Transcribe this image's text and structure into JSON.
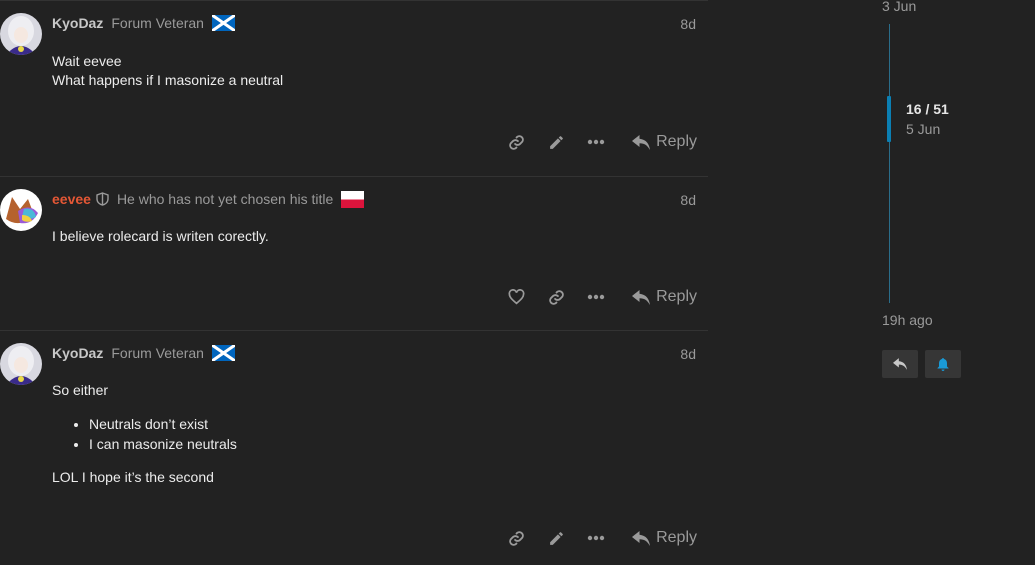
{
  "posts": [
    {
      "username": "KyoDaz",
      "title": "Forum Veteran",
      "date": "8d",
      "paragraphs": [
        "Wait eevee",
        "What happens if I masonize a neutral"
      ],
      "reply_label": "Reply"
    },
    {
      "username": "eevee",
      "title": "He who has not yet chosen his title",
      "date": "8d",
      "paragraphs": [
        "I believe rolecard is writen corectly."
      ],
      "reply_label": "Reply"
    },
    {
      "username": "KyoDaz",
      "title": "Forum Veteran",
      "date": "8d",
      "intro": "So either",
      "bullets": [
        "Neutrals don’t exist",
        "I can masonize neutrals"
      ],
      "outro": "LOL I hope it’s the second",
      "reply_label": "Reply"
    }
  ],
  "timeline": {
    "start_date": "3 Jun",
    "position": "16 / 51",
    "position_date": "5 Jun",
    "end_label": "19h ago"
  },
  "colors": {
    "background": "#222222",
    "staff_username": "#e45735",
    "timeline_accent": "#0b7fb3"
  },
  "icons": [
    "link-icon",
    "pencil-icon",
    "ellipsis-icon",
    "reply-icon",
    "heart-icon",
    "shield-icon",
    "scotland-flag-icon",
    "poland-flag-icon",
    "bell-icon"
  ]
}
